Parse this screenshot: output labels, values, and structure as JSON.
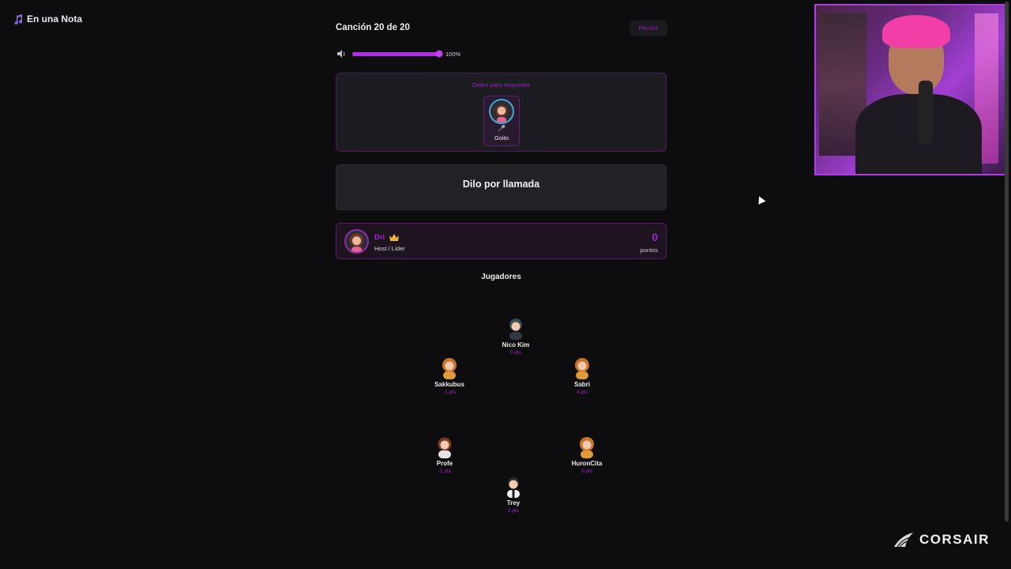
{
  "app": {
    "title": "En una Nota",
    "icon": "music-note-icon"
  },
  "song": {
    "label": "Canción 20 de 20",
    "pause_label": "PAUSA"
  },
  "volume": {
    "percent_label": "100%",
    "level": 1.0,
    "icon": "speaker-icon"
  },
  "order": {
    "title": "Orden para responder",
    "player": {
      "name": "Goito",
      "marker": "🎤"
    }
  },
  "answer": {
    "text": "Dilo por llamada"
  },
  "host": {
    "name": "Dri",
    "role": "Host / Líder",
    "score": "0",
    "score_label": "puntos",
    "badge_icon": "crown-icon"
  },
  "players_heading": "Jugadores",
  "players": [
    {
      "name": "Nico Kim",
      "score": "0 pts"
    },
    {
      "name": "Sakkubus",
      "score": "-1 pts"
    },
    {
      "name": "Sabri",
      "score": "4 pts"
    },
    {
      "name": "Profe",
      "score": "-1 pts"
    },
    {
      "name": "HuronCita",
      "score": "0 pts"
    },
    {
      "name": "Trey",
      "score": "2 pts"
    }
  ],
  "sponsor": {
    "text": "CORSAIR",
    "icon": "corsair-sails-icon"
  },
  "colors": {
    "accent": "#a61fd0",
    "background": "#0d0c0f",
    "panel": "#222126"
  }
}
